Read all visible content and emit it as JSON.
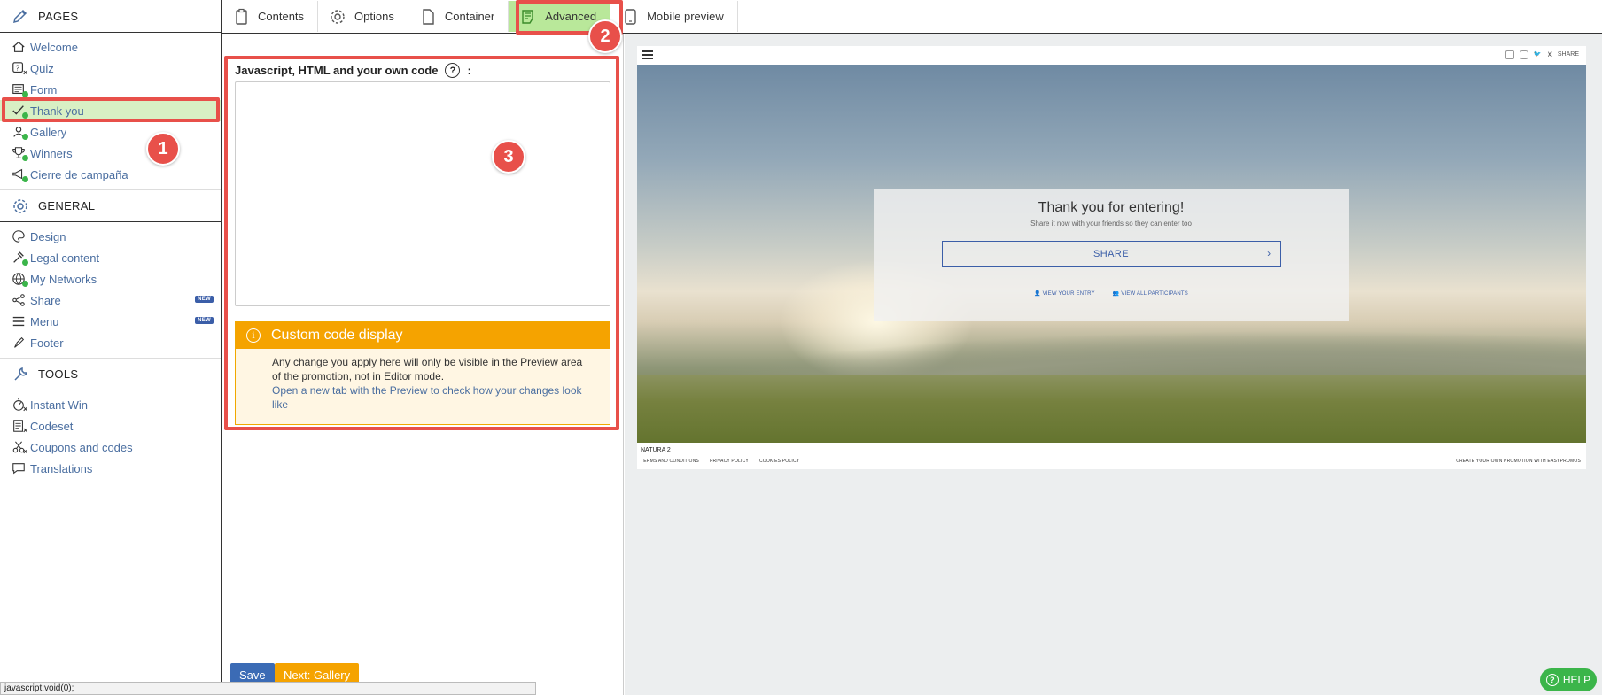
{
  "sidebar": {
    "pages_header": "PAGES",
    "pages": [
      {
        "label": "Welcome",
        "icon": "home-icon",
        "status": "none"
      },
      {
        "label": "Quiz",
        "icon": "quiz-icon",
        "status": "x"
      },
      {
        "label": "Form",
        "icon": "form-icon",
        "status": "dot"
      },
      {
        "label": "Thank you",
        "icon": "check-icon",
        "status": "dot",
        "active": true
      },
      {
        "label": "Gallery",
        "icon": "gallery-icon",
        "status": "dot"
      },
      {
        "label": "Winners",
        "icon": "trophy-icon",
        "status": "dot"
      },
      {
        "label": "Cierre de campaña",
        "icon": "megaphone-icon",
        "status": "dot"
      }
    ],
    "general_header": "GENERAL",
    "general": [
      {
        "label": "Design",
        "icon": "palette-icon",
        "status": "none"
      },
      {
        "label": "Legal content",
        "icon": "gavel-icon",
        "status": "dot"
      },
      {
        "label": "My Networks",
        "icon": "globe-icon",
        "status": "dot"
      },
      {
        "label": "Share",
        "icon": "share-icon",
        "status": "none",
        "badge": "NEW"
      },
      {
        "label": "Menu",
        "icon": "menu-icon",
        "status": "none",
        "badge": "NEW"
      },
      {
        "label": "Footer",
        "icon": "footer-icon",
        "status": "none"
      }
    ],
    "tools_header": "TOOLS",
    "tools": [
      {
        "label": "Instant Win",
        "icon": "gauge-icon",
        "status": "x"
      },
      {
        "label": "Codeset",
        "icon": "codeset-icon",
        "status": "x"
      },
      {
        "label": "Coupons and codes",
        "icon": "scissors-icon",
        "status": "x"
      },
      {
        "label": "Translations",
        "icon": "speech-icon",
        "status": "none"
      }
    ]
  },
  "tabs": [
    {
      "label": "Contents",
      "icon": "clipboard-icon"
    },
    {
      "label": "Options",
      "icon": "gear-icon"
    },
    {
      "label": "Container",
      "icon": "document-icon"
    },
    {
      "label": "Advanced",
      "icon": "advanced-icon",
      "active": true
    },
    {
      "label": "Mobile preview",
      "icon": "mobile-icon"
    }
  ],
  "editor": {
    "code_label": "Javascript, HTML and your own code",
    "code_label_suffix": ":",
    "code_value": "",
    "notice_title": "Custom code display",
    "notice_text": "Any change you apply here will only be visible in the Preview area of the promotion, not in Editor mode.",
    "notice_link": "Open a new tab with the Preview to check how your changes look like",
    "save_label": "Save",
    "next_label": "Next: Gallery"
  },
  "preview": {
    "social_share": "SHARE",
    "card_title": "Thank you for entering!",
    "card_subtitle": "Share it now with your friends so they can enter too",
    "share_button": "SHARE",
    "view_entry": "VIEW YOUR ENTRY",
    "view_participants": "VIEW ALL PARTICIPANTS",
    "footer_brand": "NATURA 2",
    "footer_links": [
      "TERMS AND CONDITIONS",
      "PRIVACY POLICY",
      "COOKIES POLICY"
    ],
    "footer_create": "CREATE YOUR OWN PROMOTION WITH EASYPROMOS"
  },
  "statusbar": "javascript:void(0);",
  "help_label": "HELP",
  "steps": [
    "1",
    "2",
    "3"
  ],
  "colors": {
    "accent_red": "#e8504a",
    "active_green": "#b9e89a",
    "notice_orange": "#f5a300",
    "link_blue": "#4a6ea0",
    "status_green": "#3bb54a"
  }
}
